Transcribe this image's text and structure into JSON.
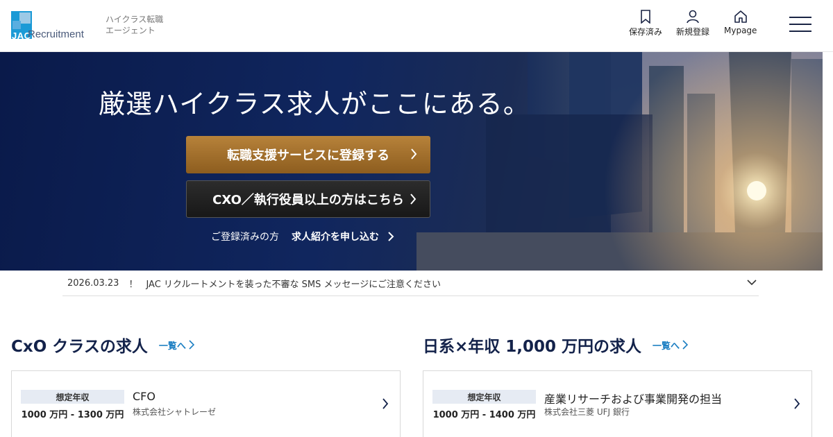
{
  "header": {
    "logo_text": "Recruitment",
    "logo_mark_text": "JAC",
    "tagline_line1": "ハイクラス転職",
    "tagline_line2": "エージェント",
    "nav": [
      {
        "label": "保存済み",
        "icon": "bookmark-icon"
      },
      {
        "label": "新規登録",
        "icon": "user-icon"
      },
      {
        "label": "Mypage",
        "icon": "home-icon"
      }
    ],
    "menu_icon": "hamburger-icon"
  },
  "hero": {
    "title": "厳選ハイクラス求人がここにある。",
    "primary_button": "転職支援サービスに登録する",
    "secondary_button": "CXO／執行役員以上の方はこちら",
    "registered_label": "ご登録済みの方",
    "registered_link": "求人紹介を申し込む"
  },
  "notice": {
    "date": "2026.03.23",
    "mark": "！",
    "text": "JAC リクルートメントを装った不審な SMS メッセージにご注意ください"
  },
  "sections": [
    {
      "title": "CxO クラスの求人",
      "more": "一覧へ",
      "job": {
        "salary_label": "想定年収",
        "salary": "1000 万円 - 1300 万円",
        "title": "CFO",
        "company": "株式会社シャトレーゼ"
      }
    },
    {
      "title": "日系×年収 1,000 万円の求人",
      "more": "一覧へ",
      "job": {
        "salary_label": "想定年収",
        "salary": "1000 万円 - 1400 万円",
        "title": "産業リサーチおよび事業開発の担当",
        "company": "株式会社三菱 UFJ 銀行"
      }
    }
  ],
  "colors": {
    "brand_blue": "#1b7ec2",
    "navy": "#13224a",
    "gold_button": "#a8742f",
    "dark_button": "#222222"
  }
}
